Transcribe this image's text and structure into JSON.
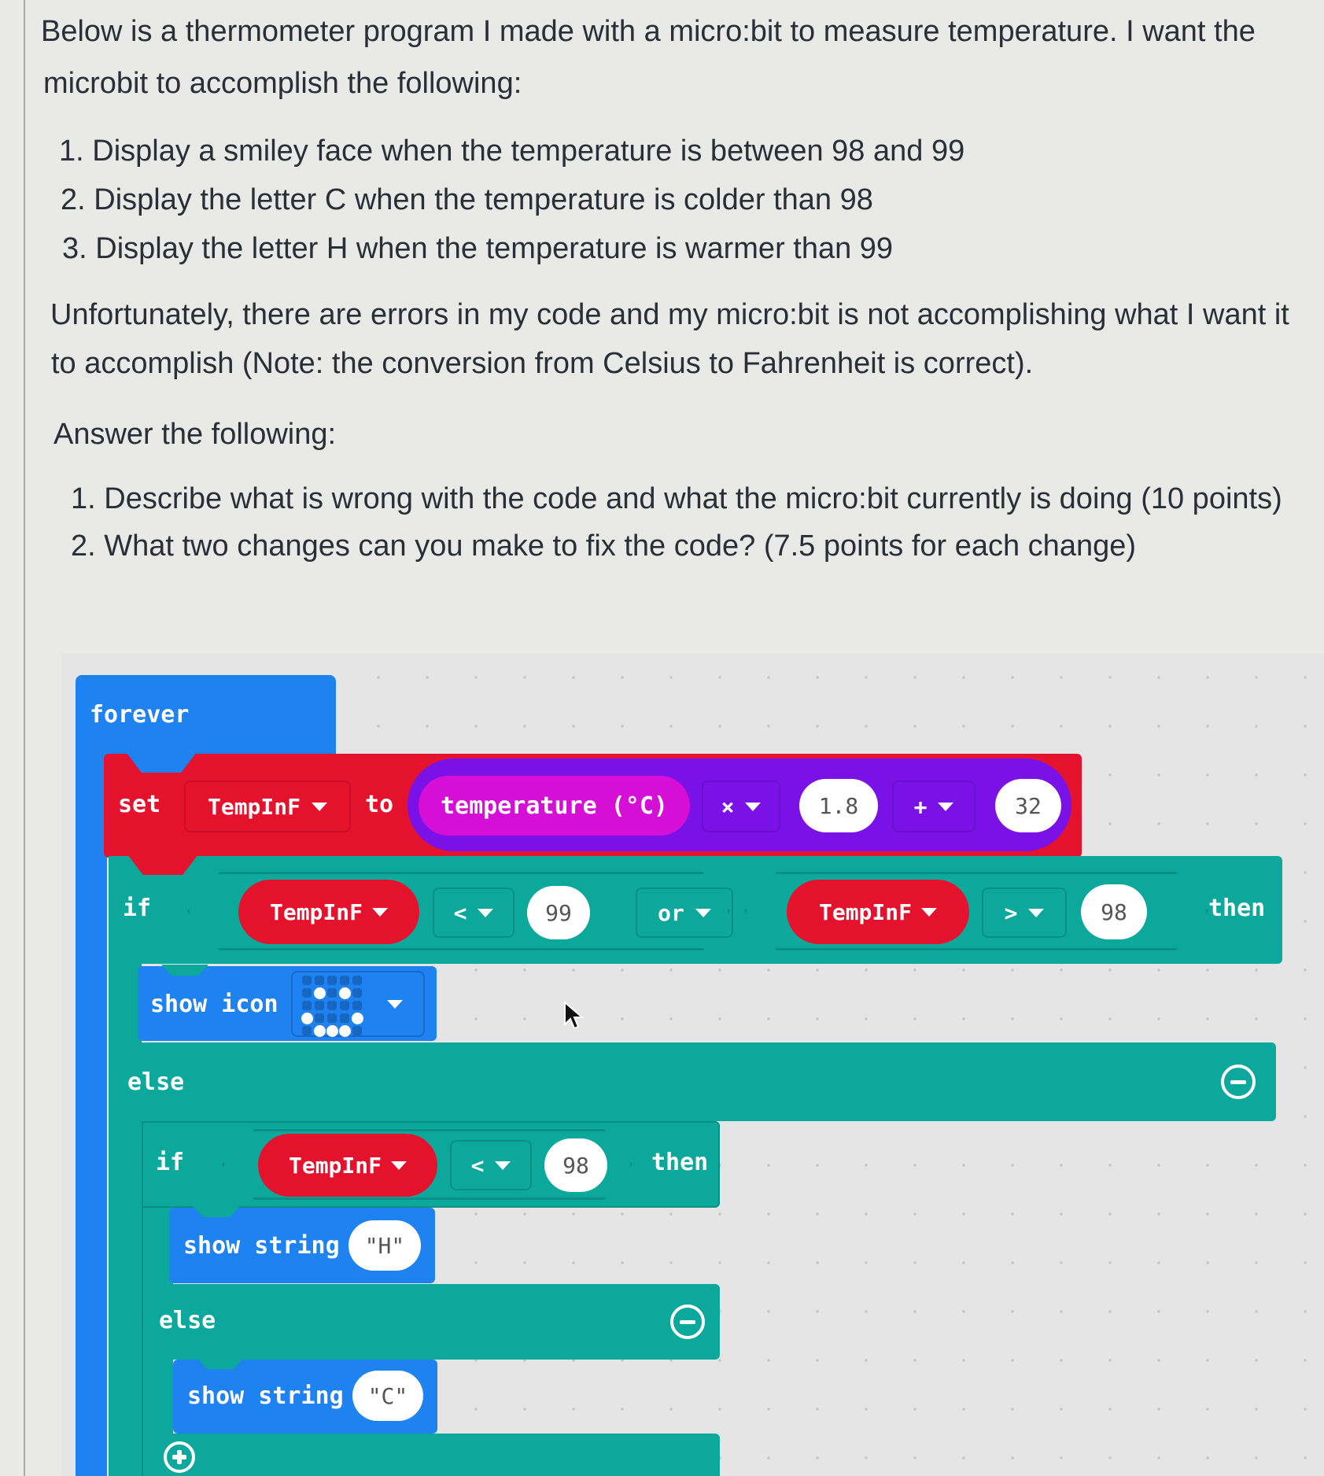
{
  "intro": {
    "line1": "Below is a thermometer program I made with a micro:bit to measure temperature. I want the",
    "line2": "microbit to accomplish the following:"
  },
  "requirements": [
    "1. Display a smiley face when the temperature is between 98 and 99",
    "2. Display the letter C when the temperature is colder than 98",
    "3. Display the letter H when the temperature is warmer than 99"
  ],
  "problem": {
    "line1": "Unfortunately, there are errors in my code and my micro:bit is not accomplishing what I want it",
    "line2": "to accomplish (Note: the conversion from Celsius to Fahrenheit is correct)."
  },
  "answer_heading": "Answer the following:",
  "questions": [
    "1. Describe what is wrong with the code and what the micro:bit currently is doing (10 points)",
    "2. What two changes can you make to fix the code? (7.5 points for each change)"
  ],
  "code": {
    "forever_label": "forever",
    "set_block": {
      "set_label": "set",
      "variable": "TempInF",
      "to_label": "to",
      "temperature_label": "temperature (°C)",
      "multiply_op": "×",
      "multiplier": "1.8",
      "add_op": "+",
      "addend": "32"
    },
    "if_block": {
      "if_label": "if",
      "left_var": "TempInF",
      "left_op": "<",
      "left_value": "99",
      "logic_op": "or",
      "right_var": "TempInF",
      "right_op": ">",
      "right_value": "98",
      "then_label": "then",
      "show_icon_label": "show icon",
      "icon_name": "smiley",
      "icon_leds": [
        [
          0,
          0,
          0,
          0,
          0
        ],
        [
          0,
          1,
          0,
          1,
          0
        ],
        [
          0,
          0,
          0,
          0,
          0
        ],
        [
          1,
          0,
          0,
          0,
          1
        ],
        [
          0,
          1,
          1,
          1,
          0
        ]
      ],
      "else_label": "else"
    },
    "inner_if_block": {
      "if_label": "if",
      "var": "TempInF",
      "op": "<",
      "value": "98",
      "then_label": "then",
      "show_string_label": "show string",
      "then_string": "\"H\"",
      "else_label": "else",
      "else_show_string_label": "show string",
      "else_string": "\"C\""
    }
  },
  "colors": {
    "loops_blue": "#1e82f0",
    "variables_red": "#e5122d",
    "math_purple": "#7a12e8",
    "input_magenta": "#d50fd6",
    "logic_teal": "#0da89c"
  }
}
